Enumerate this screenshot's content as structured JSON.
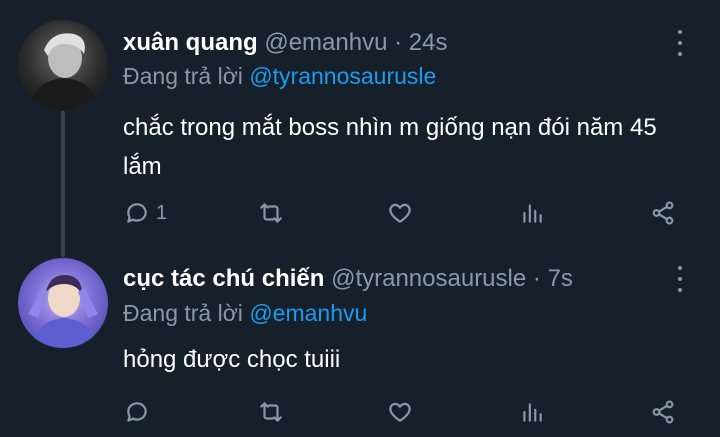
{
  "tweets": [
    {
      "display_name": "xuân quang",
      "handle": "@emanhvu",
      "separator": "·",
      "time": "24s",
      "reply_prefix": "Đang trả lời",
      "reply_to": "@tyrannosaurusle",
      "text": "chắc trong mắt boss nhìn m giống nạn đói năm 45 lắm",
      "reply_count": "1"
    },
    {
      "display_name": "cục tác chú chiến",
      "handle": "@tyrannosaurusle",
      "separator": "·",
      "time": "7s",
      "reply_prefix": "Đang trả lời",
      "reply_to": "@emanhvu",
      "text": "hỏng được chọc tuiii",
      "reply_count": ""
    }
  ],
  "colors": {
    "background": "#15202b",
    "text_primary": "#ffffff",
    "text_secondary": "#8b98a5",
    "mention": "#1d9bf0",
    "thread_line": "#38444d"
  },
  "icons": [
    "reply-icon",
    "retweet-icon",
    "like-icon",
    "stats-icon",
    "share-icon",
    "more-options-icon"
  ]
}
